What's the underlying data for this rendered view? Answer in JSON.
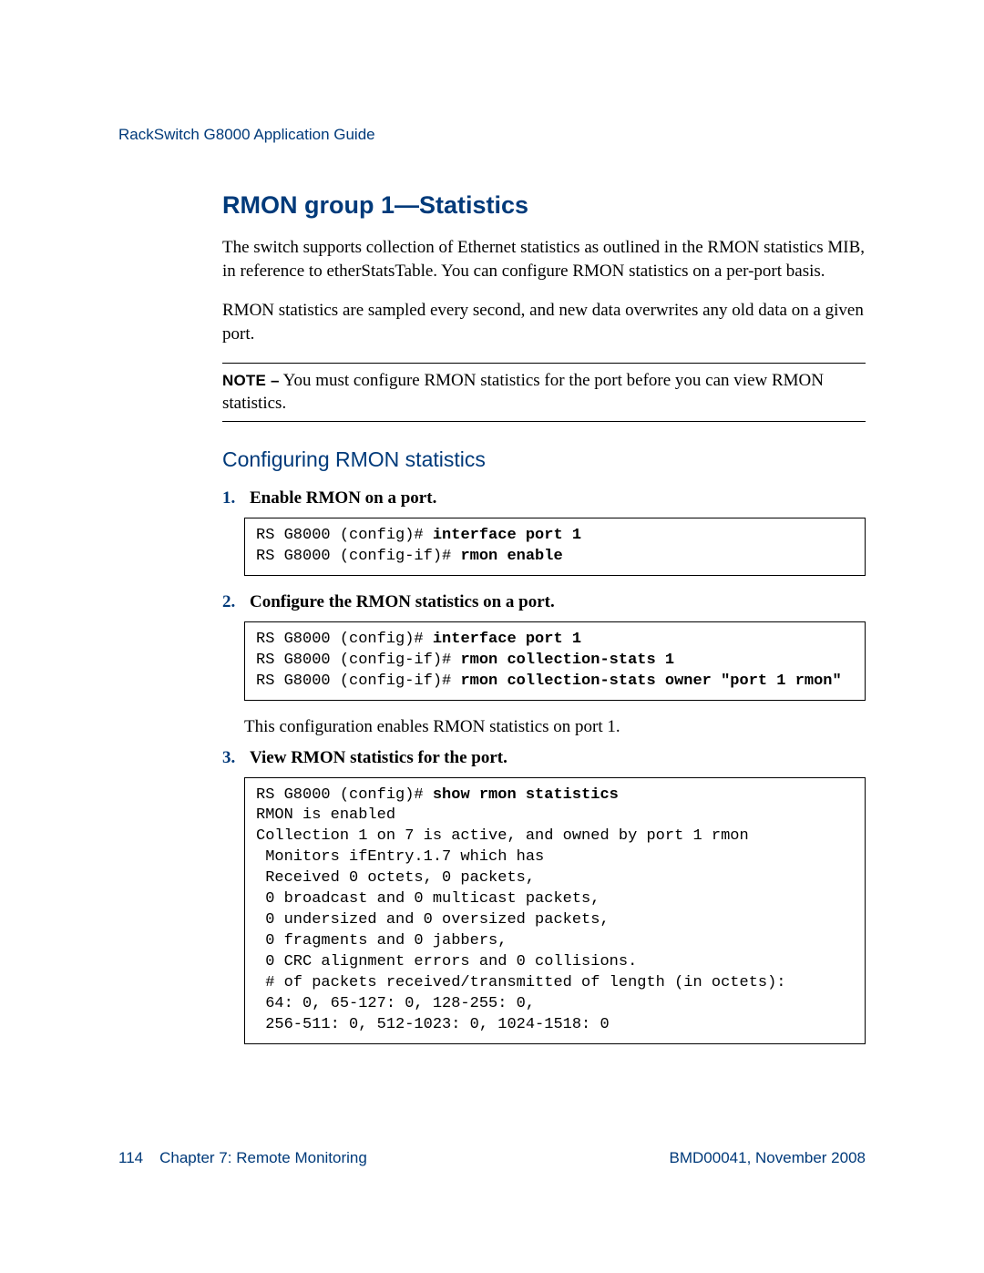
{
  "header": {
    "doc_title": "RackSwitch G8000  Application Guide"
  },
  "section": {
    "heading": "RMON group 1—Statistics",
    "para1": "The switch supports collection of Ethernet statistics as outlined in the RMON statistics MIB, in reference to etherStatsTable. You can configure RMON statistics on a per-port basis.",
    "para2": "RMON statistics are sampled every second, and new data overwrites any old data on a given port.",
    "note_label": "NOTE –",
    "note_text": " You must configure RMON statistics for the port before you can view RMON statistics.",
    "subheading": "Configuring RMON statistics",
    "step1": {
      "num": "1.",
      "text": "Enable RMON on a port.",
      "code_prefix1": "RS G8000 (config)# ",
      "code_bold1": "interface port 1",
      "code_prefix2": "RS G8000 (config-if)# ",
      "code_bold2": "rmon enable"
    },
    "step2": {
      "num": "2.",
      "text": "Configure the RMON statistics on a port.",
      "code_prefix1": "RS G8000 (config)# ",
      "code_bold1": "interface port 1",
      "code_prefix2": "RS G8000 (config-if)# ",
      "code_bold2": "rmon collection-stats 1",
      "code_prefix3": "RS G8000 (config-if)# ",
      "code_bold3": "rmon collection-stats owner \"port 1 rmon\"",
      "after": "This configuration enables RMON statistics on port 1."
    },
    "step3": {
      "num": "3.",
      "text": "View RMON statistics for the port.",
      "code_prefix1": "RS G8000 (config)# ",
      "code_bold1": "show rmon statistics",
      "code_rest": "RMON is enabled\nCollection 1 on 7 is active, and owned by port 1 rmon\n Monitors ifEntry.1.7 which has\n Received 0 octets, 0 packets,\n 0 broadcast and 0 multicast packets,\n 0 undersized and 0 oversized packets,\n 0 fragments and 0 jabbers,\n 0 CRC alignment errors and 0 collisions.\n # of packets received/transmitted of length (in octets):\n 64: 0, 65-127: 0, 128-255: 0,\n 256-511: 0, 512-1023: 0, 1024-1518: 0"
    }
  },
  "footer": {
    "page_number": "114",
    "chapter": "Chapter 7:  Remote Monitoring",
    "doc_id": "BMD00041, November 2008"
  }
}
